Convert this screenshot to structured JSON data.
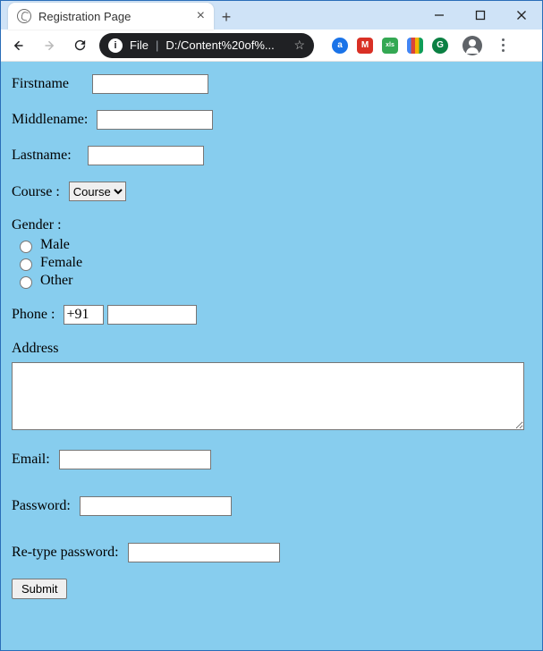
{
  "browser": {
    "tab_title": "Registration Page",
    "url_scheme_label": "File",
    "url_text": "D:/Content%20of%..."
  },
  "form": {
    "firstname_label": "Firstname",
    "middlename_label": "Middlename:",
    "lastname_label": "Lastname:",
    "course_label": "Course :",
    "course_selected": "Course",
    "gender_label": "Gender :",
    "gender_options": {
      "male": "Male",
      "female": "Female",
      "other": "Other"
    },
    "phone_label": "Phone :",
    "phone_prefix": "+91",
    "address_label": "Address",
    "email_label": "Email:",
    "password_label": "Password:",
    "retype_label": "Re-type password:",
    "submit_label": "Submit"
  }
}
